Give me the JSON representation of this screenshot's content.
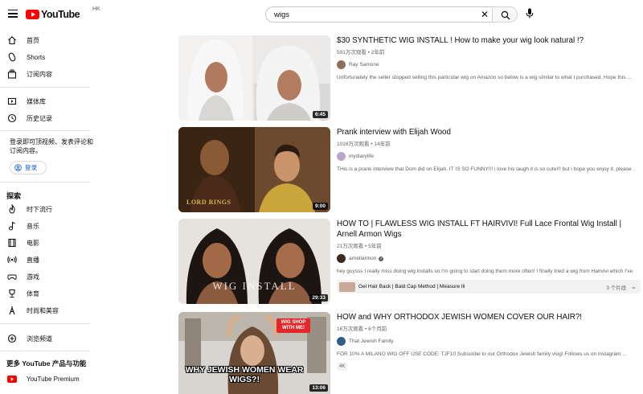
{
  "header": {
    "logo_text": "YouTube",
    "region": "HK",
    "search_value": "wigs"
  },
  "sidebar": {
    "main": [
      {
        "label": "首页",
        "icon": "home-icon"
      },
      {
        "label": "Shorts",
        "icon": "shorts-icon"
      },
      {
        "label": "订阅内容",
        "icon": "subscriptions-icon"
      }
    ],
    "library": [
      {
        "label": "媒体库",
        "icon": "library-icon"
      },
      {
        "label": "历史记录",
        "icon": "history-icon"
      }
    ],
    "signin_prompt": "登录即可顶视频、发表评论和订阅内容。",
    "signin_button": "登录",
    "explore_title": "探索",
    "explore": [
      {
        "label": "时下流行",
        "icon": "trending-icon"
      },
      {
        "label": "音乐",
        "icon": "music-icon"
      },
      {
        "label": "电影",
        "icon": "movies-icon"
      },
      {
        "label": "直播",
        "icon": "live-icon"
      },
      {
        "label": "游戏",
        "icon": "gaming-icon"
      },
      {
        "label": "体育",
        "icon": "sports-icon"
      },
      {
        "label": "时尚和美容",
        "icon": "fashion-icon"
      }
    ],
    "browse_channels": {
      "label": "浏览频道",
      "icon": "add-circle-icon"
    },
    "more_title": "更多 YouTube 产品与功能",
    "premium": {
      "label": "YouTube Premium",
      "icon": "youtube-premium-icon"
    }
  },
  "results": [
    {
      "title": "$30 SYNTHETIC WIG INSTALL ! How to make your wig look natural !?",
      "meta": "591万次观看 • 2年前",
      "channel": "Ray Samone",
      "verified": false,
      "description": "Unfortunately the seller stopped selling this particular wig on Amazon so below is a wig similar to what I purchased. Hope this ...",
      "duration": "6:45"
    },
    {
      "title": "Prank interview with Elijah Wood",
      "meta": "1016万次观看 • 14年前",
      "channel": "mydiarylife",
      "verified": false,
      "description": "THis is a prank interview that Dom did on Elijah. IT IS SO FUNNY!!! i love his laugh it is so cute!!! but i hope you enjoy it. please ...",
      "duration": "9:00",
      "thumb_text": "LORD RINGS"
    },
    {
      "title": "HOW TO | FLAWLESS WIG INSTALL FT HAIRVIVI! Full Lace Frontal Wig Install | Arnell Armon Wigs",
      "meta": "21万次观看 • 5年前",
      "channel": "arnellarmon",
      "verified": true,
      "description": "hey guysss I really miss doing wig installs so I'm going to start doing them more often! I finally tried a wig from Hairvivi which I've ...",
      "duration": "29:33",
      "thumb_text": "WIG INSTALL",
      "chapters": {
        "text": "Gel Hair Back | Bald Cap Method | Measure lli",
        "count": "3 个片段"
      }
    },
    {
      "title": "HOW and WHY ORTHODOX JEWISH WOMEN COVER OUR HAIR?!",
      "meta": "16万次观看 • 6个月前",
      "channel": "That Jewish Family",
      "verified": false,
      "description": "FOR 10% A MILANO WIG OFF USE CODE: TJF10 Subscribe to our Orthodox Jewish family vlog! Follows us on instagram ...",
      "duration": "13:06",
      "badge": "4K",
      "thumb_caption": "WHY JEWISH WOMEN WEAR WIGS?!",
      "thumb_sign": "WIG SHOP WITH ME!"
    }
  ],
  "colors": {
    "brand_red": "#ff0000",
    "link_blue": "#065fd4",
    "text_secondary": "#606060"
  }
}
